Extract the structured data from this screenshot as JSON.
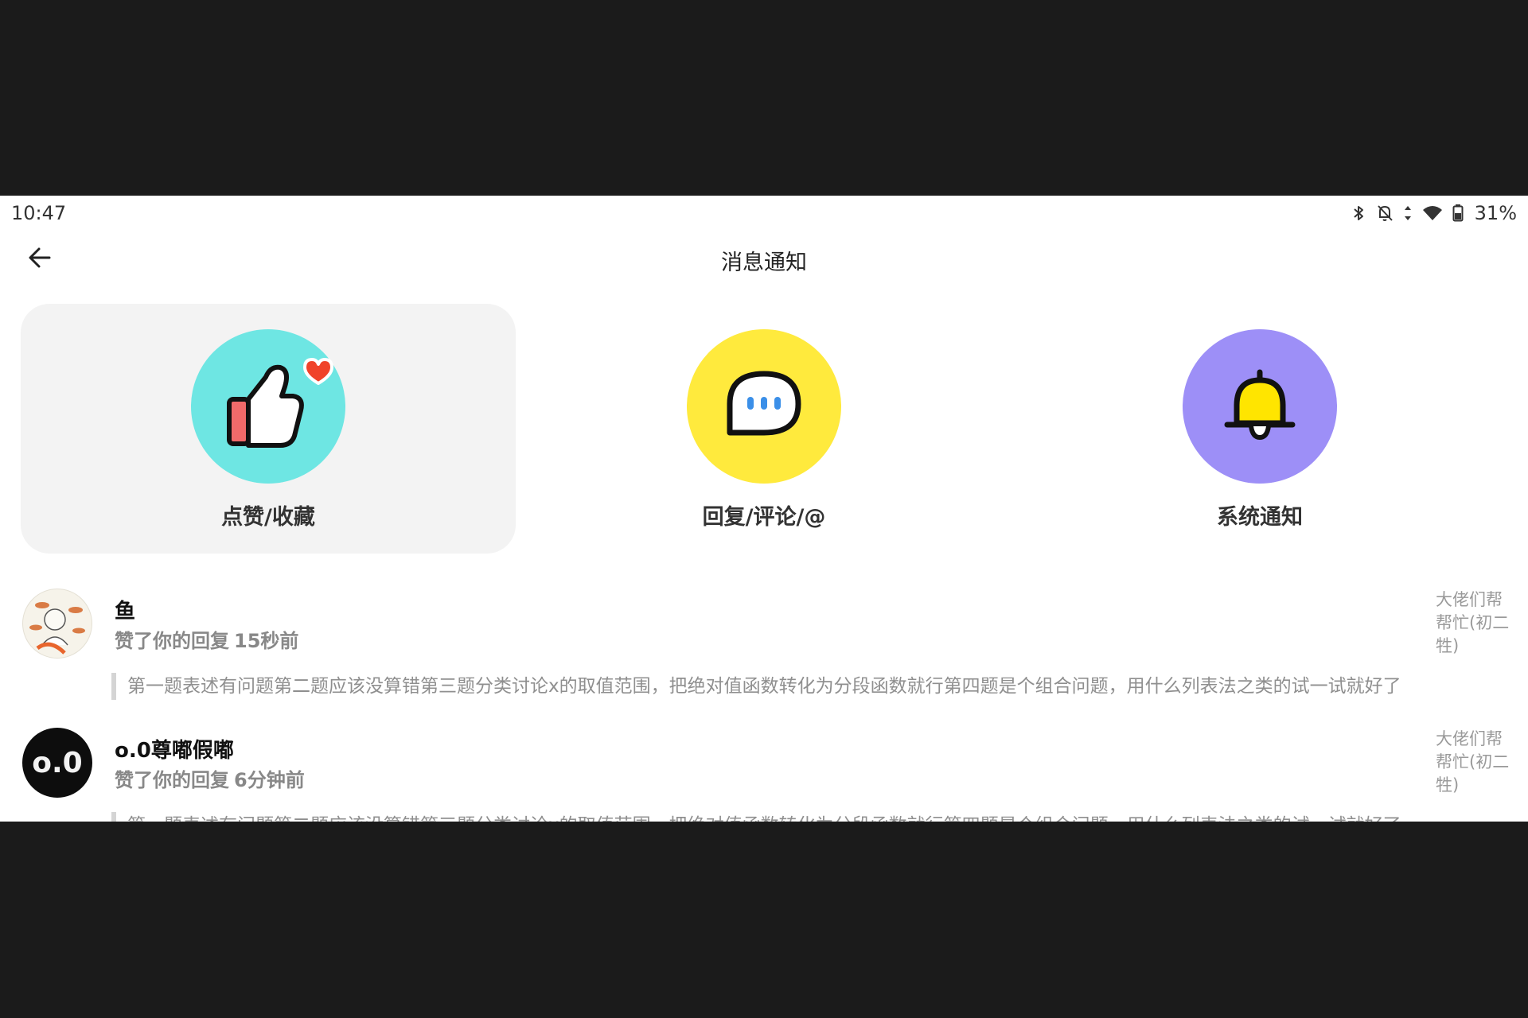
{
  "status_bar": {
    "time": "10:47",
    "battery": "31%",
    "icons": [
      "bluetooth-icon",
      "notifications-off-icon",
      "data-arrows-icon",
      "wifi-icon",
      "battery-icon"
    ]
  },
  "header": {
    "title": "消息通知",
    "back_icon": "arrow-left-icon"
  },
  "categories": [
    {
      "label": "点赞/收藏",
      "icon": "thumbs-up-heart-icon",
      "color": "#6ee6e3",
      "active": true
    },
    {
      "label": "回复/评论/@",
      "icon": "chat-bubble-icon",
      "color": "#ffea3d",
      "active": false
    },
    {
      "label": "系统通知",
      "icon": "bell-icon",
      "color": "#9d8ff7",
      "active": false
    }
  ],
  "notifications": [
    {
      "user": "鱼",
      "action": "赞了你的回复",
      "time": "15秒前",
      "quote": "第一题表述有问题第二题应该没算错第三题分类讨论x的取值范围，把绝对值函数转化为分段函数就行第四题是个组合问题，用什么列表法之类的试一试就好了",
      "source": "大佬们帮帮忙(初二牲)"
    },
    {
      "user": "o.0尊嘟假嘟",
      "avatar_text": "o.0",
      "action": "赞了你的回复",
      "time": "6分钟前",
      "quote": "第一题表述有问题第二题应该没算错第三题分类讨论x的取值范围，把绝对值函数转化为分段函数就行第四题是个组合问题，用什么列表法之类的试一试就好了",
      "source": "大佬们帮帮忙(初二牲)"
    }
  ]
}
